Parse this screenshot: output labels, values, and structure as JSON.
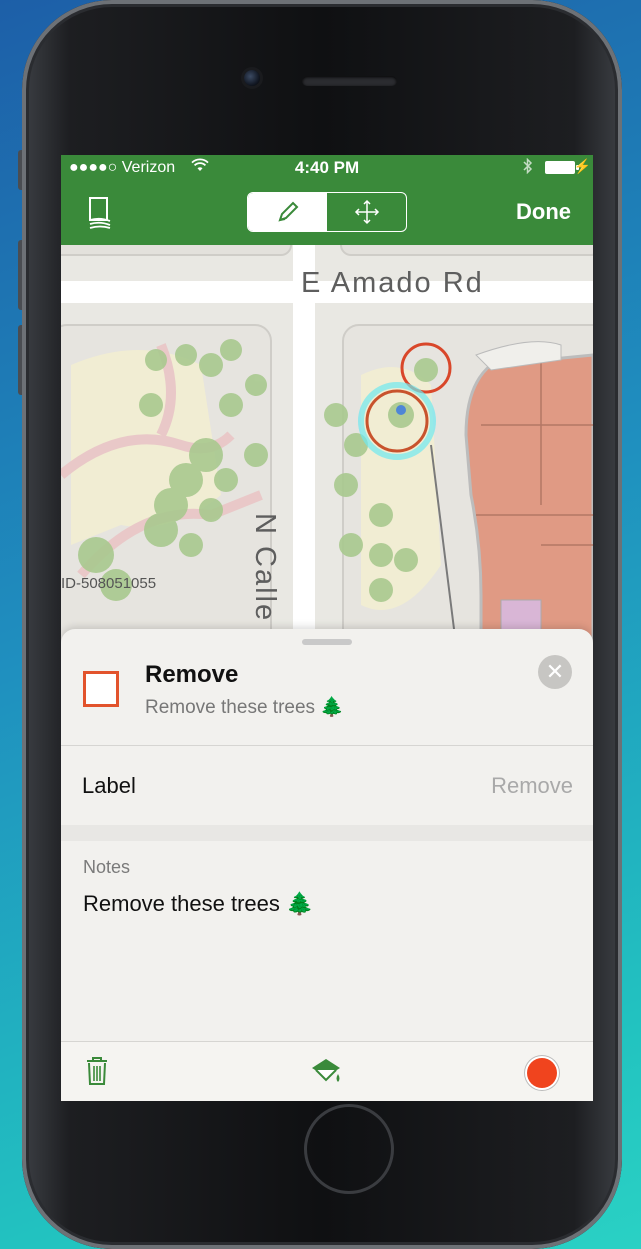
{
  "status_bar": {
    "signal": "●●●●○ Verizon",
    "wifi_icon": "wifi-icon",
    "time": "4:40 PM",
    "bluetooth_icon": "bluetooth-icon",
    "battery_icon": "battery-charging-icon"
  },
  "nav": {
    "book_icon": "basemap-book-icon",
    "segment": [
      {
        "icon": "pencil-icon",
        "selected": true
      },
      {
        "icon": "move-arrows-icon",
        "selected": false
      }
    ],
    "done_label": "Done"
  },
  "map": {
    "road_1": "E Amado Rd",
    "road_2": "N Calle",
    "parcel_id": "ID-508051055"
  },
  "feature": {
    "title": "Remove",
    "subtitle": "Remove these trees 🌲",
    "swatch_color": "#e2532c",
    "close_icon": "close-icon"
  },
  "attributes": {
    "label_key": "Label",
    "label_value": "Remove",
    "notes_title": "Notes",
    "notes_body": "Remove these trees 🌲"
  },
  "toolbar": {
    "delete_icon": "trash-icon",
    "style_icon": "paint-bucket-icon",
    "color_icon": "color-swatch-icon",
    "color": "#f0441e"
  },
  "colors": {
    "accent_green": "#3a8a3a"
  }
}
